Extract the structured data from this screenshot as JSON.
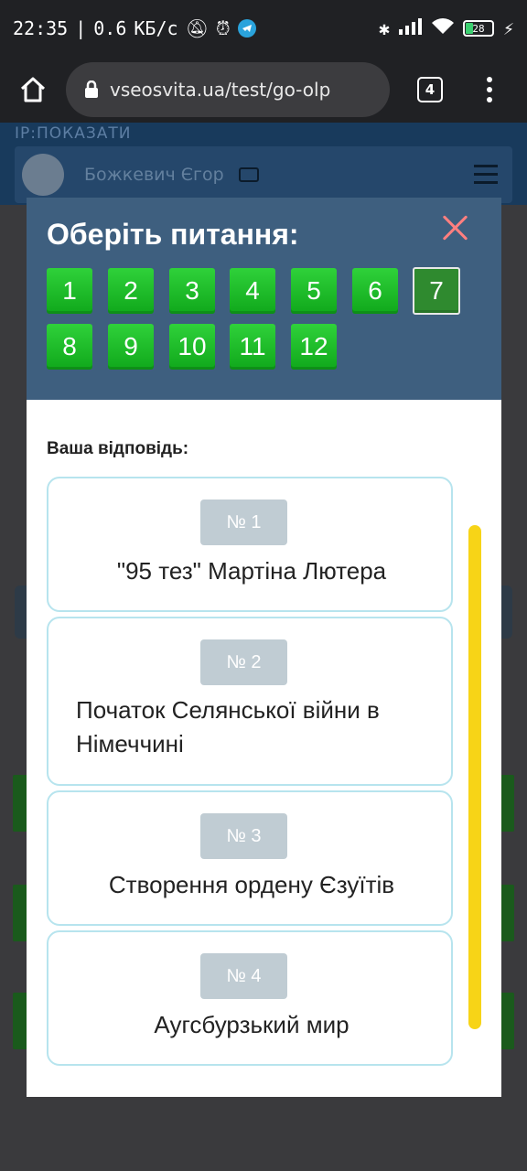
{
  "status_bar": {
    "time": "22:35",
    "separator": "|",
    "speed": "0.6",
    "speed_unit": "КБ/с",
    "battery": "28"
  },
  "browser": {
    "url": "vseosvita.ua/test/go-olp",
    "tab_count": "4"
  },
  "background_page": {
    "ip_label": "IP:ПОКАЗАТИ",
    "user_name": "Божкевич Єгор"
  },
  "modal": {
    "title": "Оберіть питання:",
    "questions": [
      "1",
      "2",
      "3",
      "4",
      "5",
      "6",
      "7",
      "8",
      "9",
      "10",
      "11",
      "12"
    ],
    "active_question": "7",
    "answer_label": "Ваша відповідь:",
    "options": [
      {
        "num": "№ 1",
        "text": "\"95 тез\" Мартіна Лютера"
      },
      {
        "num": "№ 2",
        "text": "Початок Селянської війни в Німеччині"
      },
      {
        "num": "№ 3",
        "text": "Створення ордену Єзуїтів"
      },
      {
        "num": "№ 4",
        "text": "Аугсбурзький мир"
      }
    ]
  },
  "colors": {
    "modal_header": "#3e5f7f",
    "question_green": "#1fbf2a",
    "close": "#ff7f7f",
    "option_border": "#b7e4ee",
    "scrollbar": "#f7d417"
  }
}
